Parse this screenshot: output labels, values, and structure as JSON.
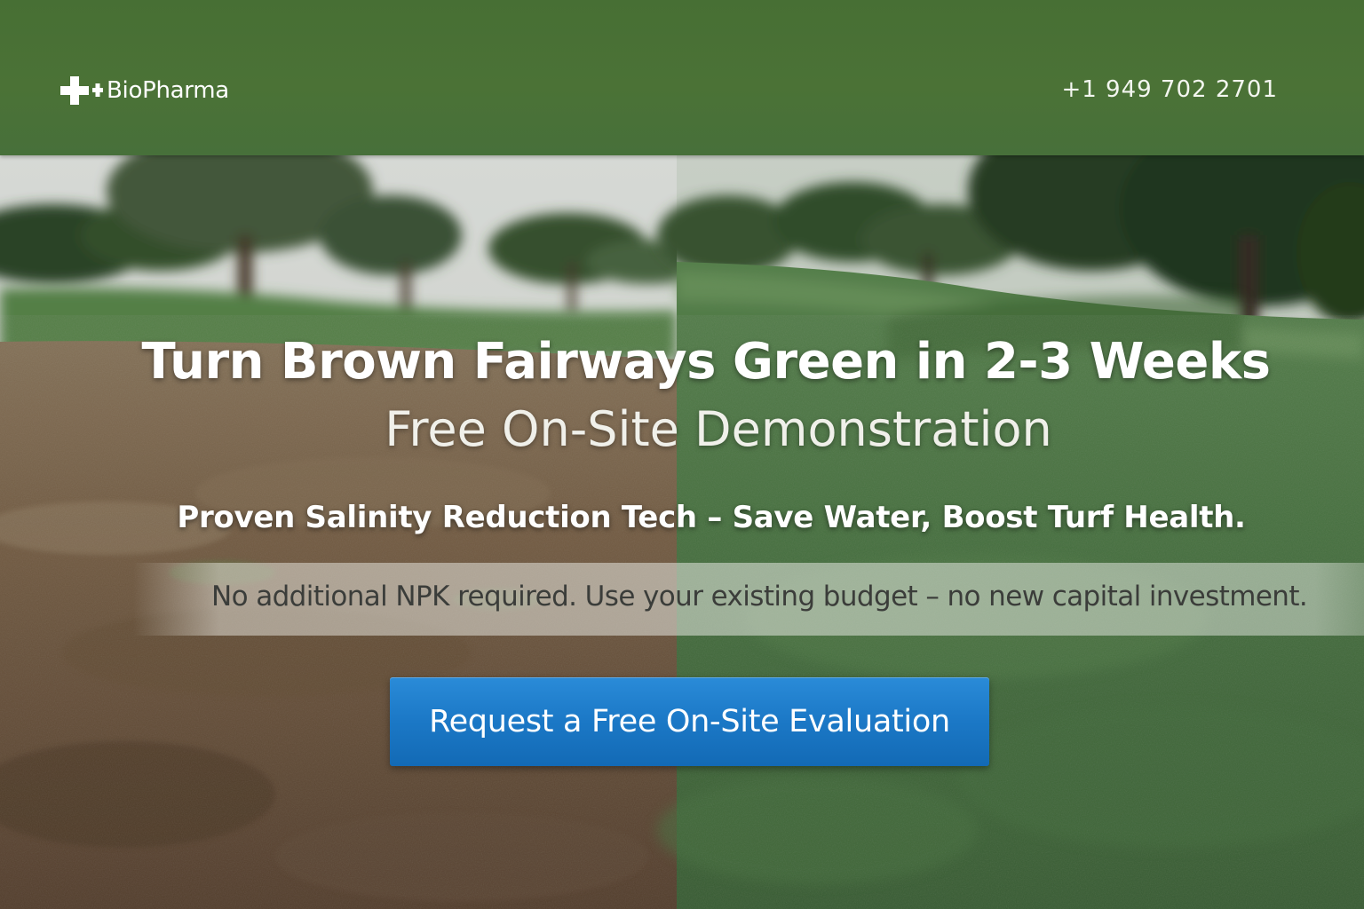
{
  "brand": {
    "name": "BioPharma",
    "logo_icon": "medical-cross-icon",
    "phone": "+1 949 702 2701"
  },
  "hero": {
    "headline": "Turn Brown Fairways Green in 2-3 Weeks",
    "subheadline": "Free On-Site Demonstration",
    "tagline": "Proven Salinity Reduction Tech – Save Water, Boost Turf Health.",
    "note": "No additional NPK required. Use your existing budget – no new capital investment.",
    "cta_label": "Request a Free On-Site Evaluation"
  },
  "colors": {
    "header_green": "#4b7236",
    "cta_blue": "#1b78c6",
    "text_white": "#ffffff"
  }
}
